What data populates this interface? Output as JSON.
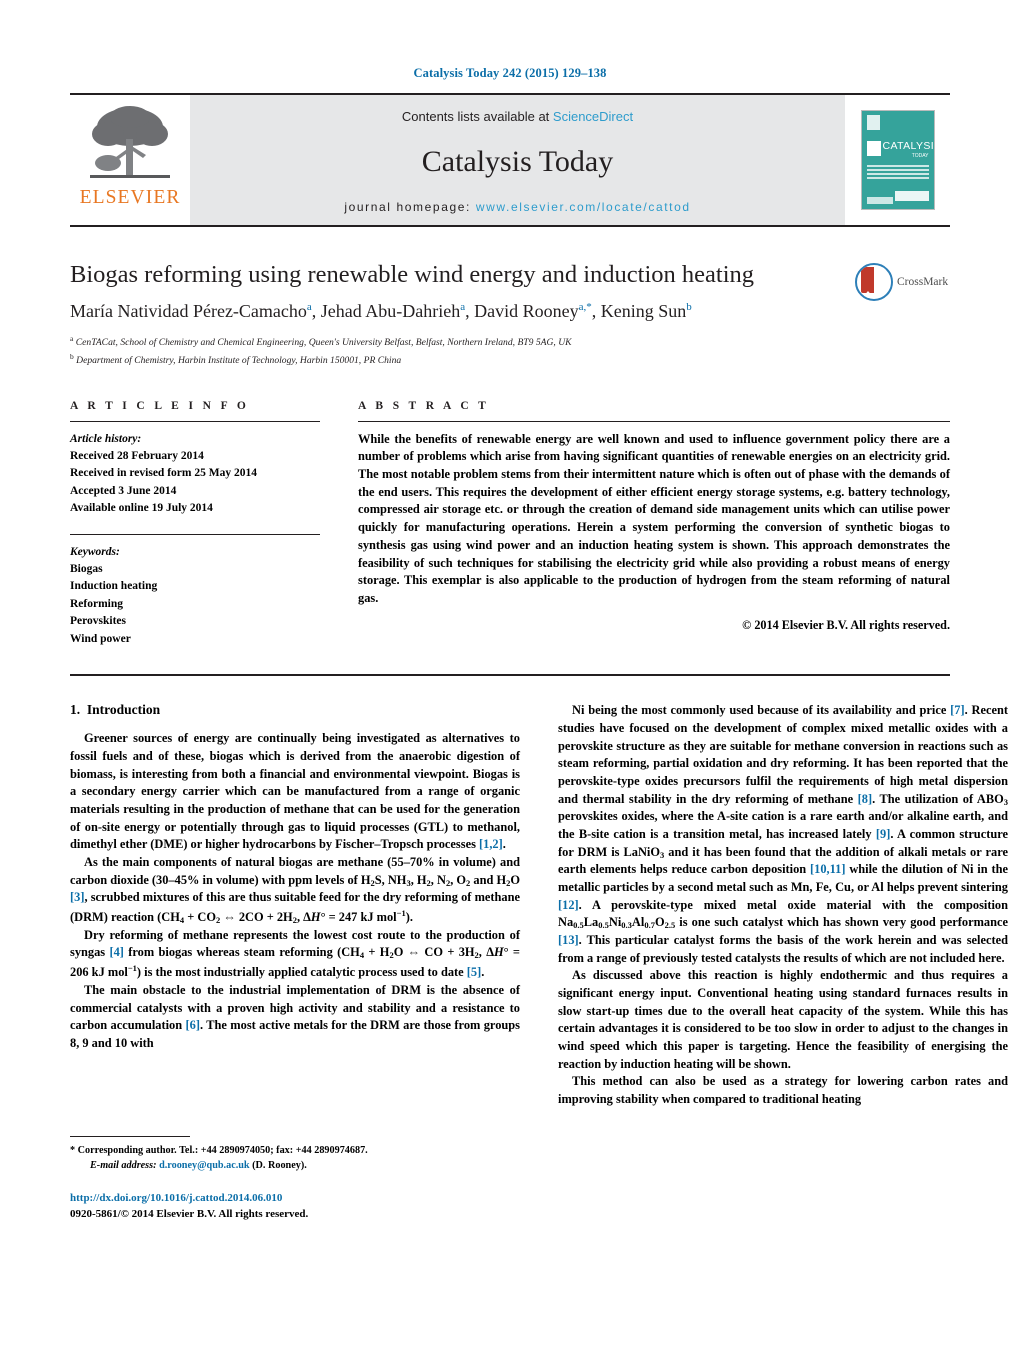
{
  "running_head": "Catalysis Today 242 (2015) 129–138",
  "masthead": {
    "contents_prefix": "Contents lists available at ",
    "contents_link": "ScienceDirect",
    "journal_title": "Catalysis Today",
    "homepage_label": "journal homepage:",
    "homepage_url": "www.elsevier.com/locate/cattod",
    "publisher_wordmark": "ELSEVIER",
    "cover": {
      "title": "CATALYSIS",
      "subtitle": "TODAY"
    }
  },
  "article": {
    "title": "Biogas reforming using renewable wind energy and induction heating",
    "crossmark_label": "CrossMark",
    "authors": [
      {
        "name": "María Natividad Pérez-Camacho",
        "marks": "a"
      },
      {
        "name": "Jehad Abu-Dahrieh",
        "marks": "a"
      },
      {
        "name": "David Rooney",
        "marks": "a,*"
      },
      {
        "name": "Kening Sun",
        "marks": "b"
      }
    ],
    "affiliations": [
      {
        "mark": "a",
        "text": "CenTACat, School of Chemistry and Chemical Engineering, Queen's University Belfast, Belfast, Northern Ireland, BT9 5AG, UK"
      },
      {
        "mark": "b",
        "text": "Department of Chemistry, Harbin Institute of Technology, Harbin 150001, PR China"
      }
    ]
  },
  "article_info": {
    "heading": "A R T I C L E   I N F O",
    "history_title": "Article history:",
    "history": [
      "Received 28 February 2014",
      "Received in revised form 25 May 2014",
      "Accepted 3 June 2014",
      "Available online 19 July 2014"
    ],
    "keywords_title": "Keywords:",
    "keywords": [
      "Biogas",
      "Induction heating",
      "Reforming",
      "Perovskites",
      "Wind power"
    ]
  },
  "abstract": {
    "heading": "A B S T R A C T",
    "text": "While the benefits of renewable energy are well known and used to influence government policy there are a number of problems which arise from having significant quantities of renewable energies on an electricity grid. The most notable problem stems from their intermittent nature which is often out of phase with the demands of the end users. This requires the development of either efficient energy storage systems, e.g. battery technology, compressed air storage etc. or through the creation of demand side management units which can utilise power quickly for manufacturing operations. Herein a system performing the conversion of synthetic biogas to synthesis gas using wind power and an induction heating system is shown. This approach demonstrates the feasibility of such techniques for stabilising the electricity grid while also providing a robust means of energy storage. This exemplar is also applicable to the production of hydrogen from the steam reforming of natural gas.",
    "copyright": "© 2014 Elsevier B.V. All rights reserved."
  },
  "body": {
    "section_number": "1.",
    "section_title": "Introduction",
    "left_paragraphs": [
      "Greener sources of energy are continually being investigated as alternatives to fossil fuels and of these, biogas which is derived from the anaerobic digestion of biomass, is interesting from both a financial and environmental viewpoint. Biogas is a secondary energy carrier which can be manufactured from a range of organic materials resulting in the production of methane that can be used for the generation of on-site energy or potentially through gas to liquid processes (GTL) to methanol, dimethyl ether (DME) or higher hydrocarbons by Fischer–Tropsch processes [1,2].",
      "As the main components of natural biogas are methane (55–70% in volume) and carbon dioxide (30–45% in volume) with ppm levels of H2S, NH3, H2, N2, O2 and H2O [3], scrubbed mixtures of this are thus suitable feed for the dry reforming of methane (DRM) reaction (CH4 + CO2 ⇔ 2CO + 2H2, ΔH° = 247 kJ mol−1).",
      "Dry reforming of methane represents the lowest cost route to the production of syngas [4] from biogas whereas steam reforming (CH4 + H2O ⇔ CO + 3H2, ΔH° = 206 kJ mol−1) is the most industrially applied catalytic process used to date [5].",
      "The main obstacle to the industrial implementation of DRM is the absence of commercial catalysts with a proven high activity and stability and a resistance to carbon accumulation [6]. The most active metals for the DRM are those from groups 8, 9 and 10 with"
    ],
    "right_paragraphs": [
      "Ni being the most commonly used because of its availability and price [7]. Recent studies have focused on the development of complex mixed metallic oxides with a perovskite structure as they are suitable for methane conversion in reactions such as steam reforming, partial oxidation and dry reforming. It has been reported that the perovskite-type oxides precursors fulfil the requirements of high metal dispersion and thermal stability in the dry reforming of methane [8]. The utilization of ABO3 perovskites oxides, where the A-site cation is a rare earth and/or alkaline earth, and the B-site cation is a transition metal, has increased lately [9]. A common structure for DRM is LaNiO3 and it has been found that the addition of alkali metals or rare earth elements helps reduce carbon deposition [10,11] while the dilution of Ni in the metallic particles by a second metal such as Mn, Fe, Cu, or Al helps prevent sintering [12]. A perovskite-type mixed metal oxide material with the composition Na0.5La0.5Ni0.3Al0.7O2.5 is one such catalyst which has shown very good performance [13]. This particular catalyst forms the basis of the work herein and was selected from a range of previously tested catalysts the results of which are not included here.",
      "As discussed above this reaction is highly endothermic and thus requires a significant energy input. Conventional heating using standard furnaces results in slow start-up times due to the overall heat capacity of the system. While this has certain advantages it is considered to be too slow in order to adjust to the changes in wind speed which this paper is targeting. Hence the feasibility of energising the reaction by induction heating will be shown.",
      "This method can also be used as a strategy for lowering carbon rates and improving stability when compared to traditional heating"
    ]
  },
  "footnotes": {
    "corresponding_marker": "*",
    "corresponding_text": "Corresponding author. Tel.: +44 2890974050; fax: +44 2890974687.",
    "email_label": "E-mail address:",
    "email": "d.rooney@qub.ac.uk",
    "email_owner": "(D. Rooney).",
    "doi": "http://dx.doi.org/10.1016/j.cattod.2014.06.010",
    "issn_line": "0920-5861/© 2014 Elsevier B.V. All rights reserved."
  }
}
